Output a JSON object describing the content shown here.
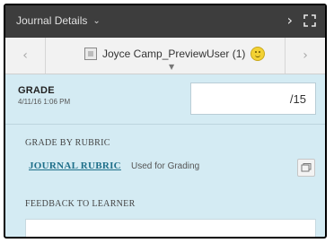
{
  "header": {
    "title": "Journal Details",
    "title_dropdown_icon": "chevron-down-icon",
    "next_icon": "chevron-right-icon",
    "expand_icon": "expand-icon"
  },
  "user_nav": {
    "prev_icon": "chevron-left-icon",
    "next_icon": "chevron-right-icon",
    "user_label": "Joyce Camp_PreviewUser (1)",
    "status_icon": "smiley-icon"
  },
  "grade": {
    "label": "GRADE",
    "date": "4/11/16 1:06 PM",
    "value": "",
    "max": "/15"
  },
  "rubric": {
    "heading": "GRADE BY RUBRIC",
    "link": "JOURNAL RUBRIC",
    "status": "Used for Grading",
    "open_icon": "open-window-icon"
  },
  "feedback": {
    "heading": "FEEDBACK TO LEARNER",
    "value": ""
  },
  "colors": {
    "header_bg": "#3d3d3d",
    "panel_bg": "#d4ebf3",
    "link": "#1e6f8a"
  }
}
